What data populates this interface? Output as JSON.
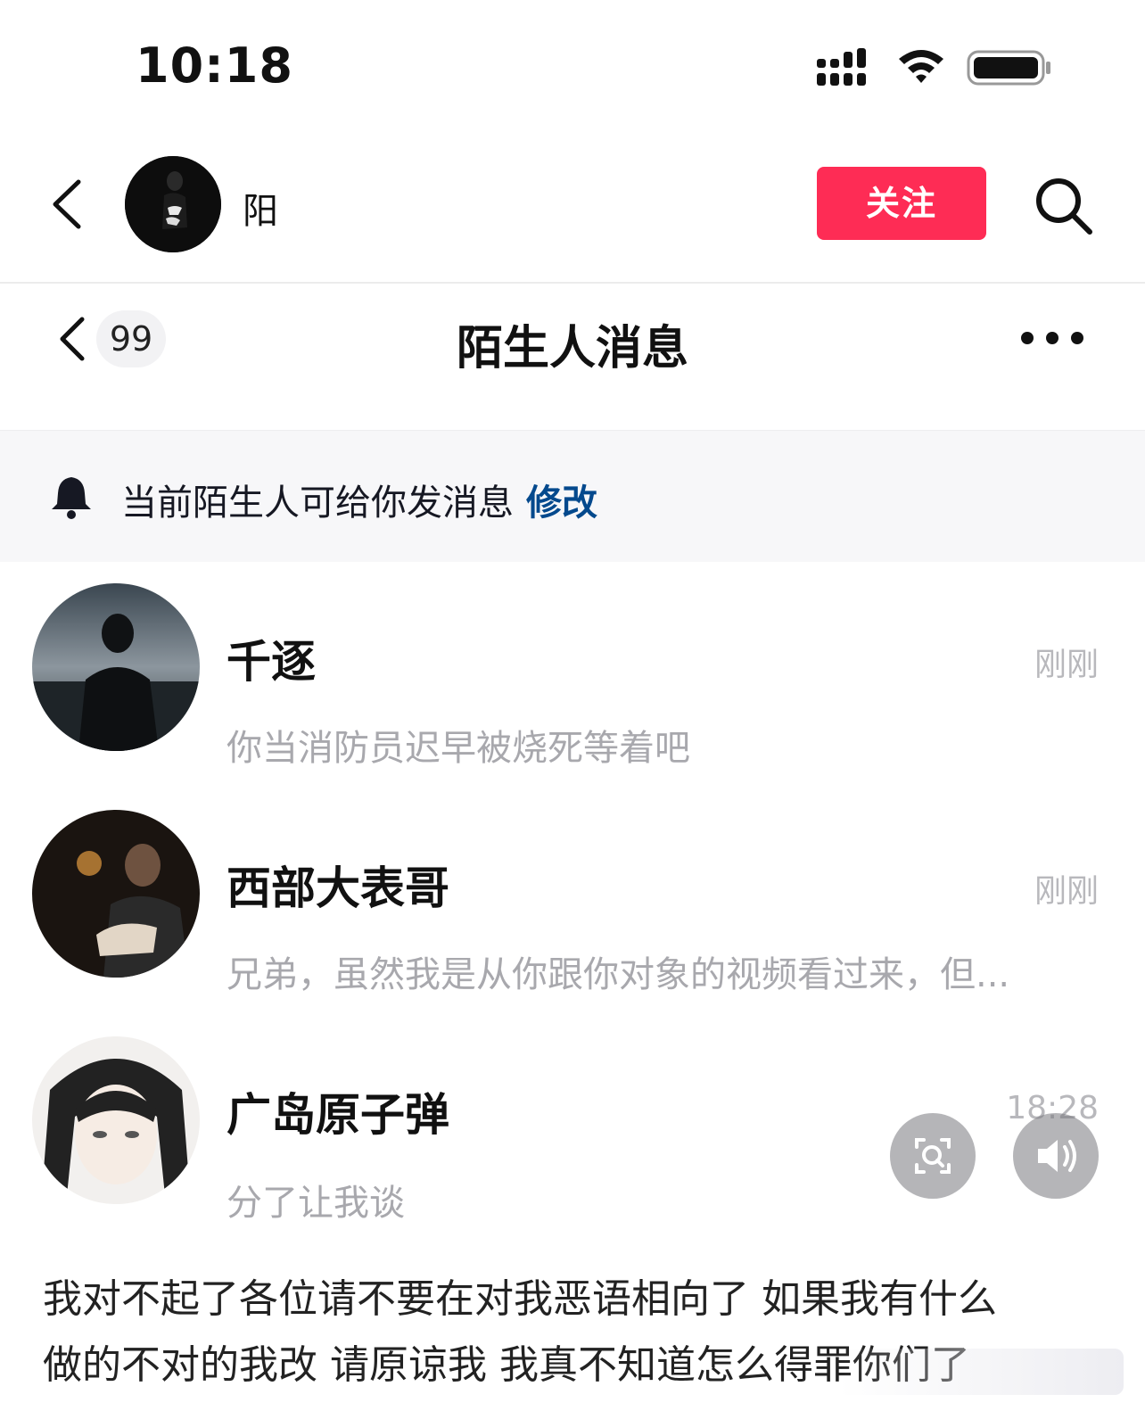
{
  "status_bar": {
    "time": "10:18"
  },
  "profile": {
    "name": "阳",
    "follow_label": "关注"
  },
  "stranger_nav": {
    "unread_count": "99",
    "title": "陌生人消息"
  },
  "notice": {
    "text": "当前陌生人可给你发消息",
    "action": "修改"
  },
  "messages": [
    {
      "name": "千逐",
      "time": "刚刚",
      "preview": "你当消防员迟早被烧死等着吧"
    },
    {
      "name": "西部大表哥",
      "time": "刚刚",
      "preview": "兄弟，虽然我是从你跟你对象的视频看过来，但..."
    },
    {
      "name": "广岛原子弹",
      "time": "18:28",
      "preview": "分了让我谈"
    }
  ],
  "caption": {
    "line1": "我对不起了各位请不要在对我恶语相向了 如果我有什么",
    "line2": "做的不对的我改 请原谅我 我真不知道怎么得罪你们了"
  },
  "colors": {
    "accent": "#fe2c55",
    "link": "#04498d",
    "muted": "#a8a8ad"
  },
  "icons": [
    "signal-icon",
    "wifi-icon",
    "battery-icon",
    "back-icon",
    "search-icon",
    "more-icon",
    "bell-icon",
    "scan-icon",
    "speaker-icon"
  ]
}
